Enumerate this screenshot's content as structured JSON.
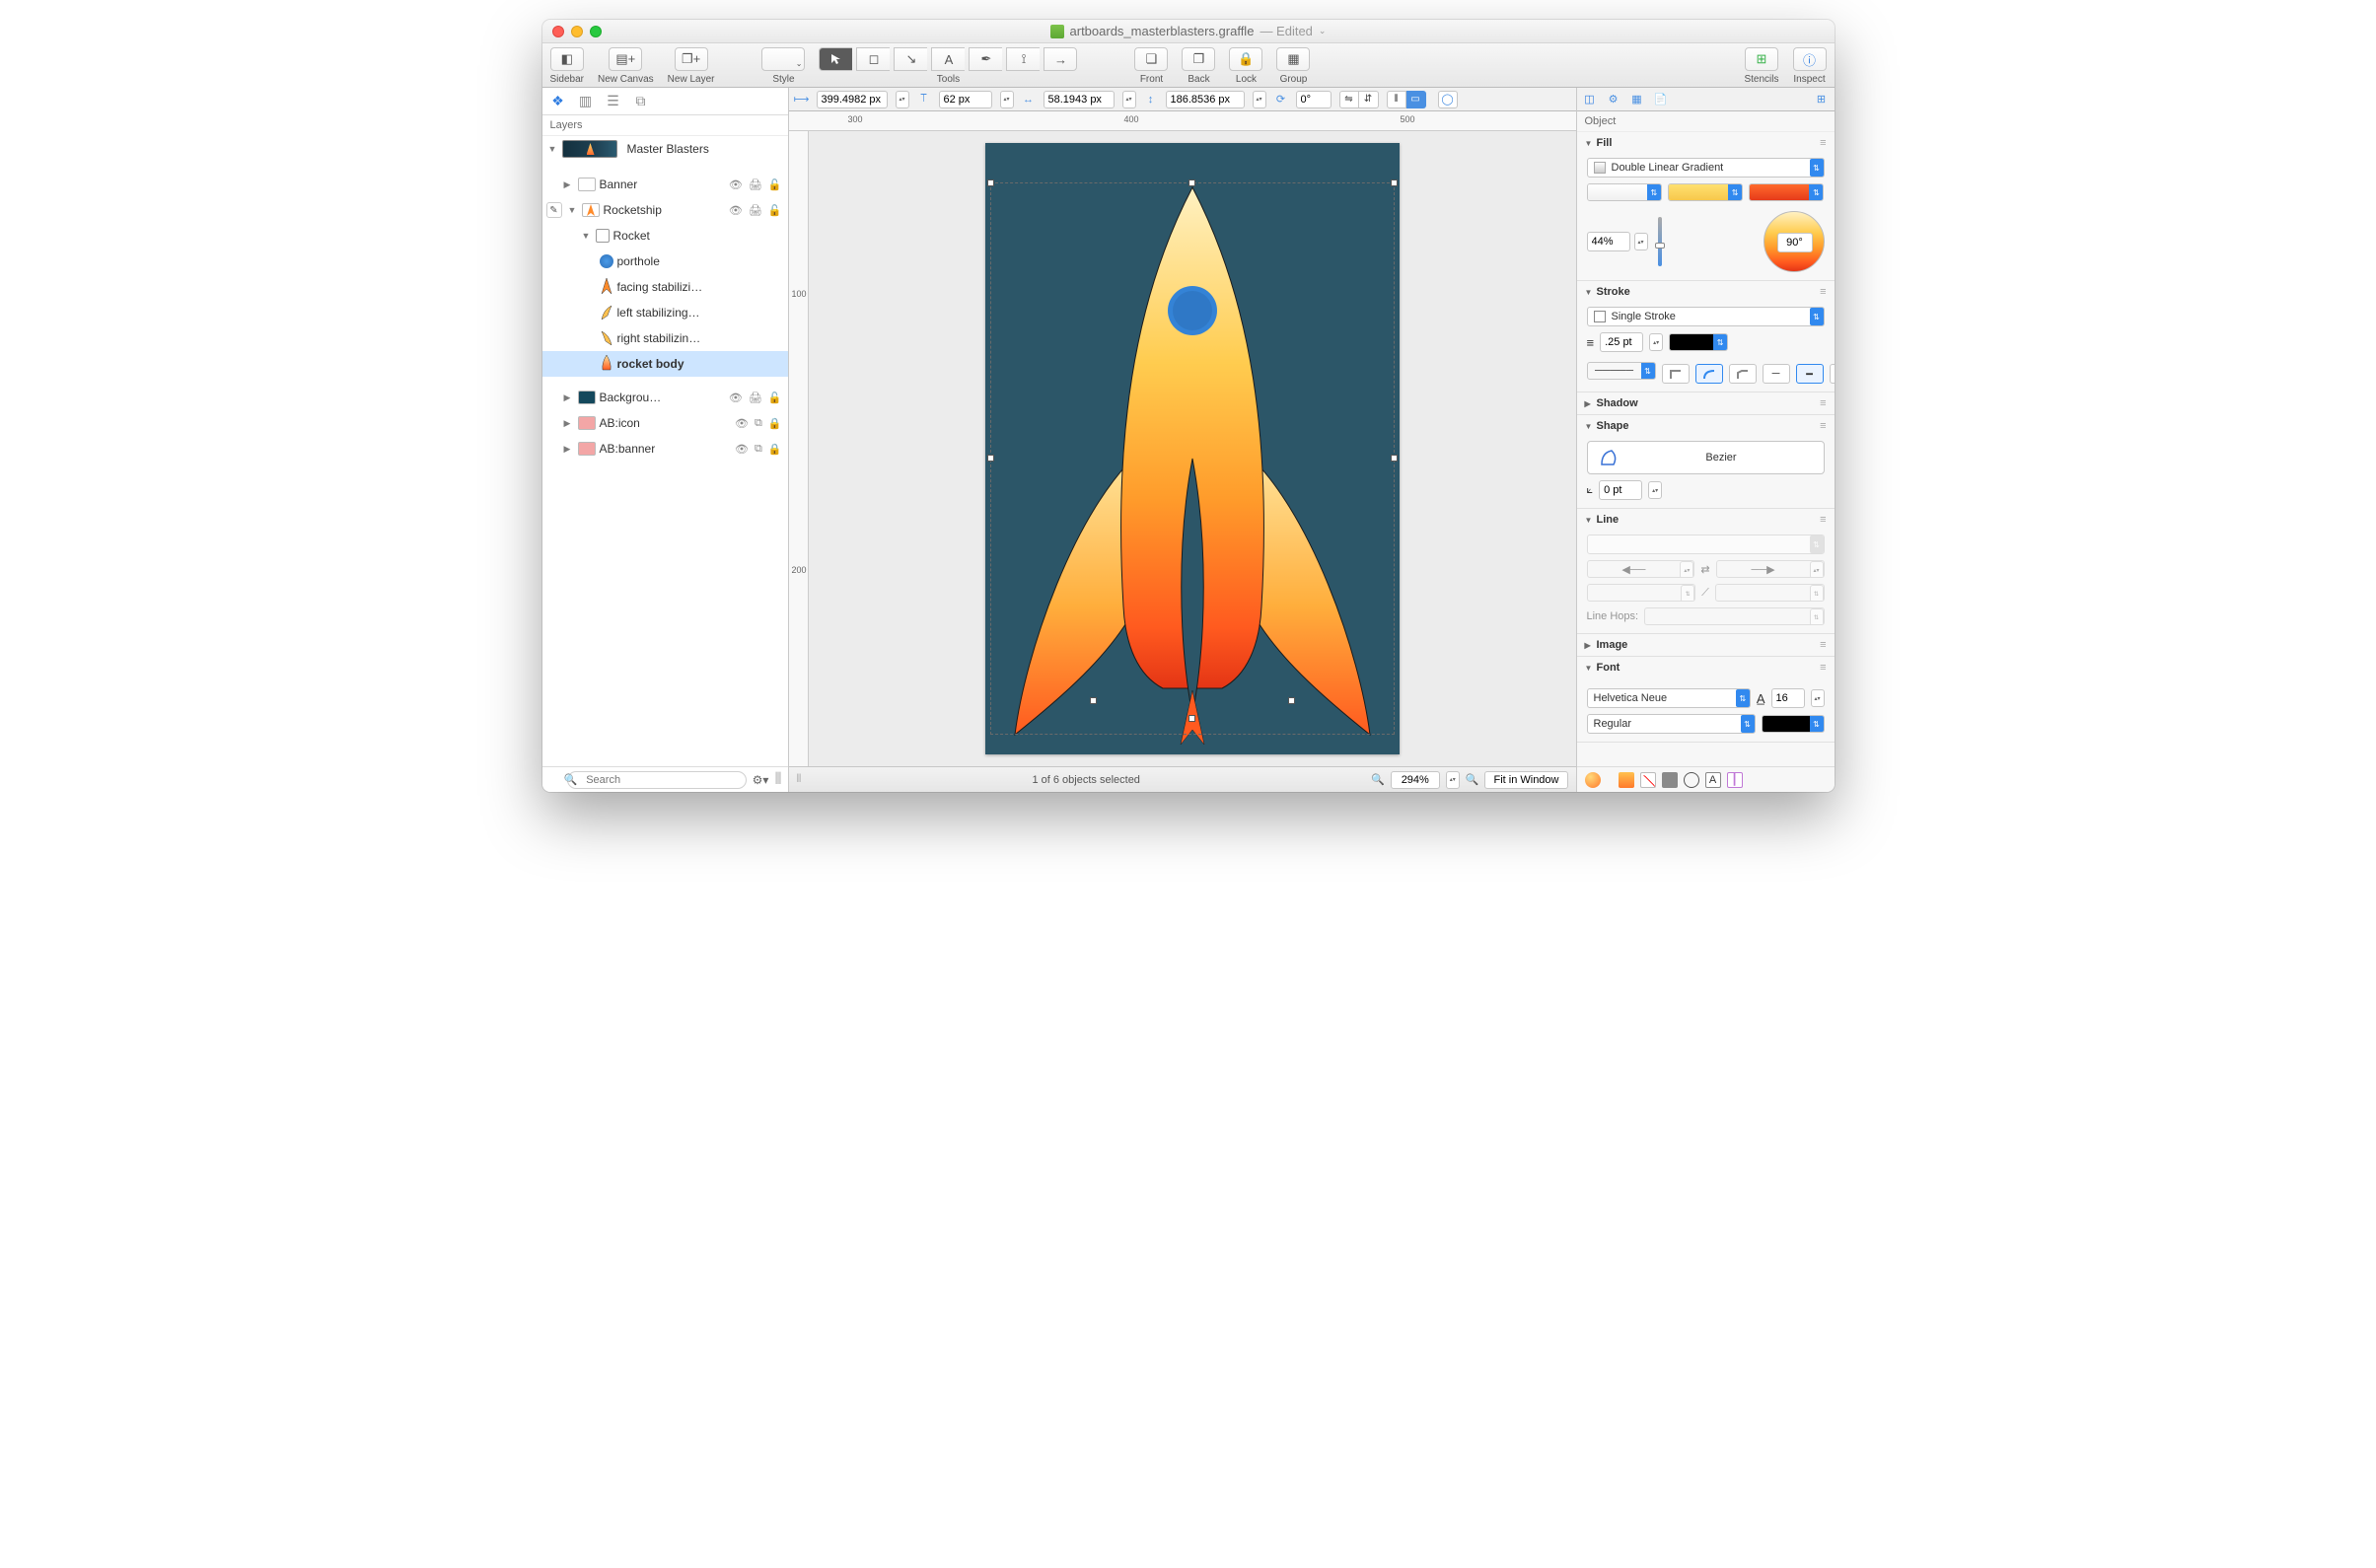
{
  "window": {
    "filename": "artboards_masterblasters.graffle",
    "edited_suffix": "— Edited"
  },
  "toolbar": {
    "sidebar": "Sidebar",
    "new_canvas": "New Canvas",
    "new_layer": "New Layer",
    "style": "Style",
    "tools": "Tools",
    "front": "Front",
    "back": "Back",
    "lock": "Lock",
    "group": "Group",
    "stencils": "Stencils",
    "inspect": "Inspect"
  },
  "propsbar": {
    "x": "399.4982 px",
    "y": "62 px",
    "w": "58.1943 px",
    "h": "186.8536 px",
    "rotation": "0°"
  },
  "ruler": {
    "h": [
      "300",
      "400",
      "500"
    ],
    "v": [
      "100",
      "200"
    ]
  },
  "sidebar": {
    "tab_label": "Layers",
    "canvas_name": "Master Blasters",
    "layers": [
      {
        "name": "Banner",
        "depth": 1,
        "arrow": "▶",
        "swatch": "#ffffff",
        "icons": [
          "eye",
          "print",
          "lock-open"
        ]
      },
      {
        "name": "Rocketship",
        "depth": 1,
        "arrow": "▼",
        "swatch": "rocket-mini",
        "icons": [
          "eye",
          "print",
          "lock-open"
        ],
        "pencil": true
      },
      {
        "name": "Rocket",
        "depth": 2,
        "arrow": "▼",
        "icon": "group"
      },
      {
        "name": "porthole",
        "depth": 3,
        "icon": "circle-blue"
      },
      {
        "name": "facing stabilizi…",
        "depth": 3,
        "icon": "fin-orange"
      },
      {
        "name": "left stabilizing…",
        "depth": 3,
        "icon": "fin-left"
      },
      {
        "name": "right stabilizin…",
        "depth": 3,
        "icon": "fin-right"
      },
      {
        "name": "rocket body",
        "depth": 3,
        "icon": "rocket-body",
        "selected": true
      },
      {
        "name": "Backgrou…",
        "depth": 1,
        "arrow": "▶",
        "swatch": "#14485c",
        "icons": [
          "eye",
          "print",
          "lock-open"
        ]
      },
      {
        "name": "AB:icon",
        "depth": 1,
        "arrow": "▶",
        "swatch": "#f3a6a6",
        "icons": [
          "eye",
          "artboard",
          "lock"
        ]
      },
      {
        "name": "AB:banner",
        "depth": 1,
        "arrow": "▶",
        "swatch": "#f3a6a6",
        "icons": [
          "eye",
          "artboard",
          "lock"
        ]
      }
    ],
    "search_placeholder": "Search"
  },
  "status": {
    "selection": "1 of 6 objects selected",
    "zoom": "294%",
    "fit": "Fit in Window"
  },
  "inspector": {
    "header": "Object",
    "fill": {
      "title": "Fill",
      "type": "Double Linear Gradient",
      "stops": [
        "#ffffff",
        "#f7c84b",
        "#e63a1a"
      ],
      "mid": "44%",
      "angle": "90°"
    },
    "stroke": {
      "title": "Stroke",
      "type": "Single Stroke",
      "width": ".25 pt"
    },
    "shadow": {
      "title": "Shadow"
    },
    "shape": {
      "title": "Shape",
      "name": "Bezier",
      "corner": "0 pt"
    },
    "line": {
      "title": "Line",
      "hops": "Line Hops:"
    },
    "image": {
      "title": "Image"
    },
    "font": {
      "title": "Font",
      "family": "Helvetica Neue",
      "size": "16",
      "weight": "Regular"
    }
  }
}
